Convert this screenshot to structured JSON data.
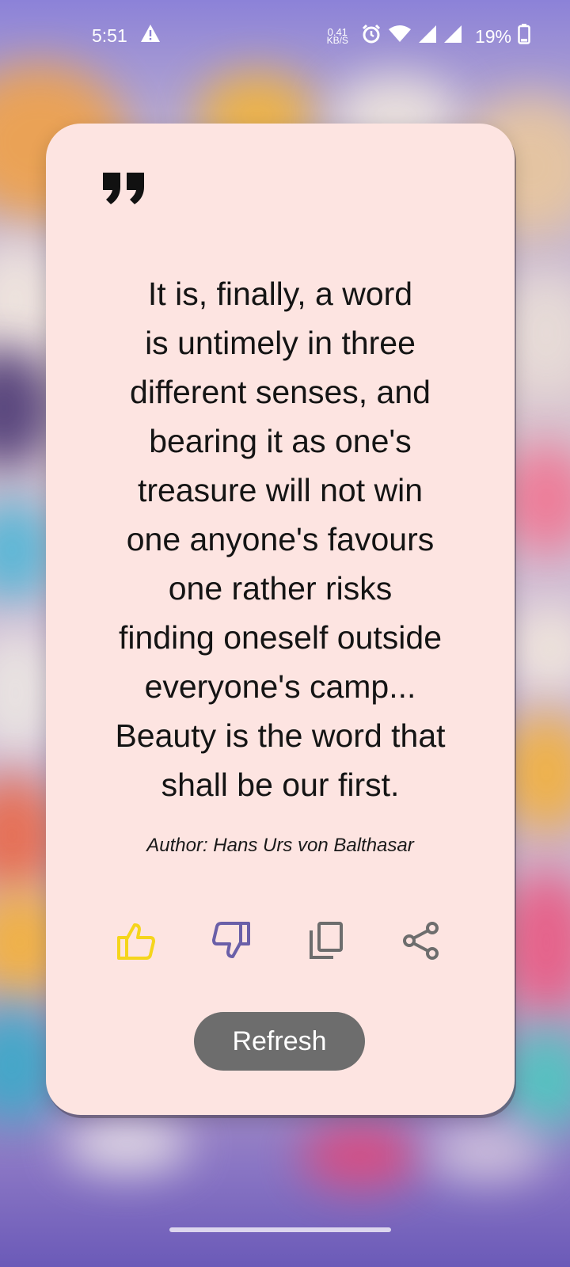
{
  "status_bar": {
    "time": "5:51",
    "alert_icon": "warning-triangle-icon",
    "net_speed_value": "0.41",
    "net_speed_unit": "KB/S",
    "icons": [
      "alarm-icon",
      "wifi-icon",
      "signal-icon",
      "signal-icon",
      "battery-icon"
    ],
    "battery": "19%"
  },
  "quote": {
    "text": "It is, finally, a word\nis untimely in three\ndifferent senses, and\nbearing it as one's\ntreasure will not win\none anyone's favours\none rather risks\nfinding oneself outside\neveryone's camp...\nBeauty is the word that\nshall be our first.",
    "author": "Author: Hans Urs von Balthasar"
  },
  "actions": [
    {
      "name": "like",
      "icon": "thumbs-up-icon",
      "color": "#f5d51c"
    },
    {
      "name": "dislike",
      "icon": "thumbs-down-icon",
      "color": "#6a5fa8"
    },
    {
      "name": "copy",
      "icon": "copy-icon",
      "color": "#6d6d6d"
    },
    {
      "name": "share",
      "icon": "share-icon",
      "color": "#6d6d6d"
    }
  ],
  "refresh_label": "Refresh",
  "colors": {
    "card_background": "#fde4e1",
    "button_background": "#6d6d6d",
    "like_accent": "#f5d51c",
    "dislike_accent": "#6a5fa8"
  }
}
